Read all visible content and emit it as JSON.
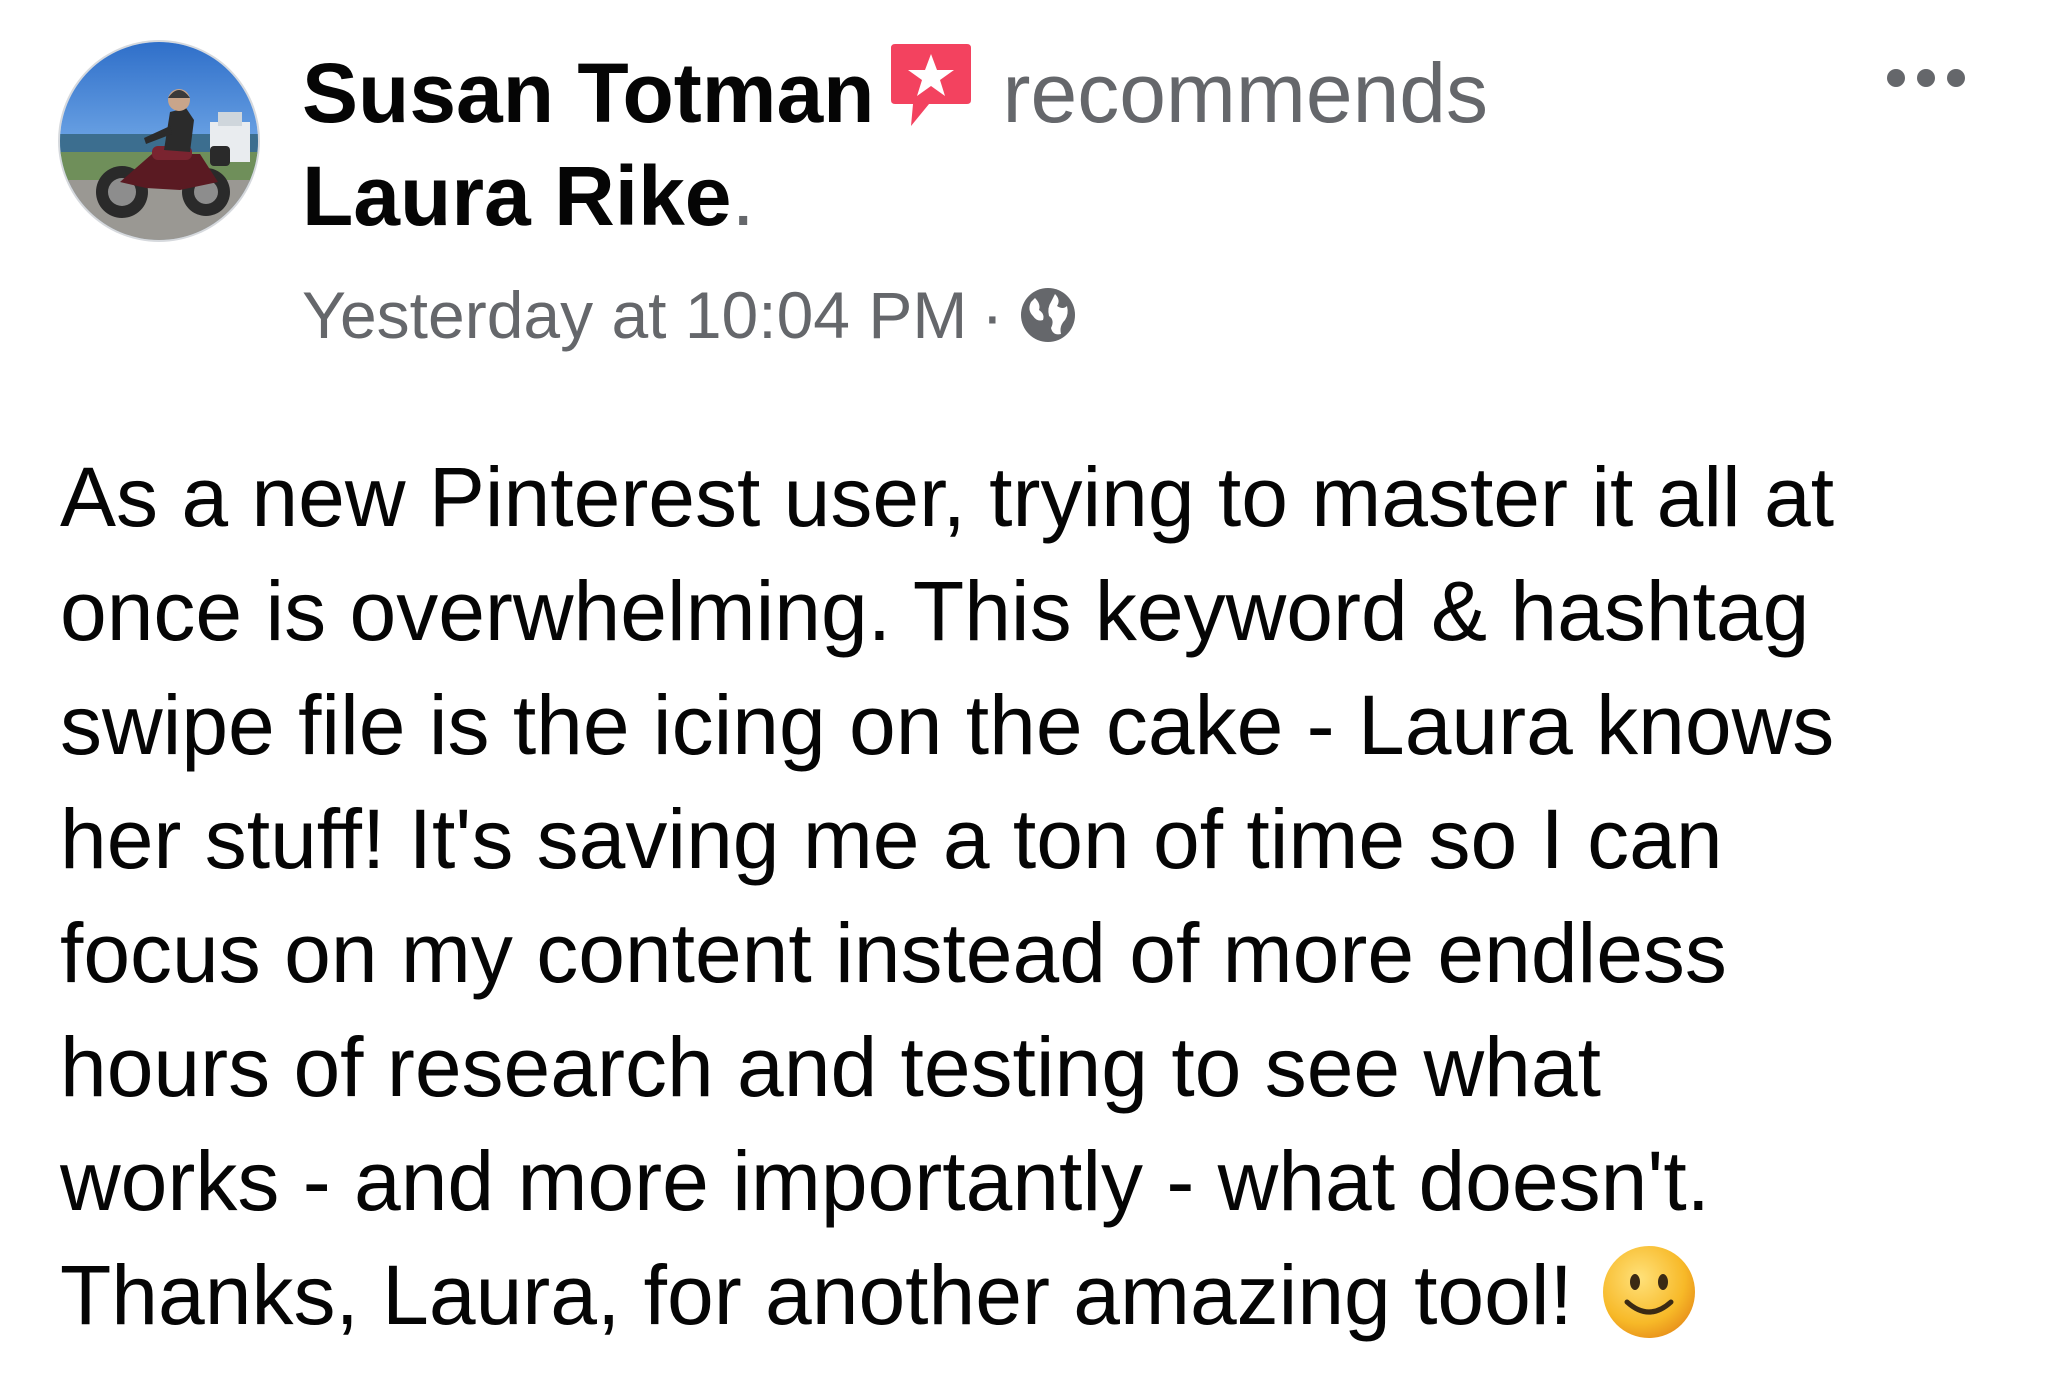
{
  "post": {
    "author": "Susan Totman",
    "action": "recommends",
    "target": "Laura Rike",
    "punctuation": ".",
    "timestamp": "Yesterday at 10:04 PM",
    "separator": "·",
    "audience_icon": "globe-icon",
    "badge_icon": "recommendation-star-icon",
    "menu_icon": "more-options-icon",
    "emoji_icon": "smiling-face-emoji",
    "body_lines": [
      "As a new Pinterest user, trying to master it all at",
      "once is overwhelming. This keyword & hashtag",
      "swipe file is the icing on the cake - Laura knows",
      "her stuff! It's saving me a ton of time so I can",
      "focus on my content instead of more endless",
      "hours of research and testing to see what",
      "works - and more importantly - what doesn't.",
      "Thanks, Laura, for another amazing tool!"
    ]
  },
  "colors": {
    "badge": "#f3425f",
    "name": "#050505",
    "muted": "#65676b",
    "emoji": "#f7b928"
  }
}
